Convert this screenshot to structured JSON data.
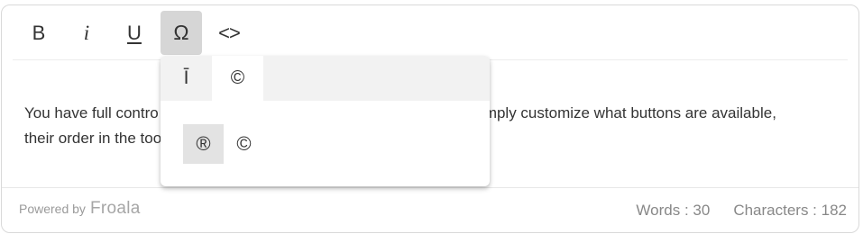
{
  "toolbar": {
    "bold": "B",
    "italic": "i",
    "underline": "U",
    "special_characters": "Ω",
    "code_view": "<>"
  },
  "content": {
    "line1_left": "You have full contro",
    "line1_right": "Simply customize what buttons are available,",
    "line2_left": "their order in the too"
  },
  "footer": {
    "powered_by": "Powered by",
    "brand": "Froala",
    "words": "Words : 30",
    "characters": "Characters : 182"
  },
  "special_chars_popup": {
    "tabs": [
      {
        "label": "Ī",
        "selected": false
      },
      {
        "label": "©",
        "selected": true
      }
    ],
    "symbols": [
      "®",
      "©"
    ],
    "hovered_symbol": "®"
  }
}
